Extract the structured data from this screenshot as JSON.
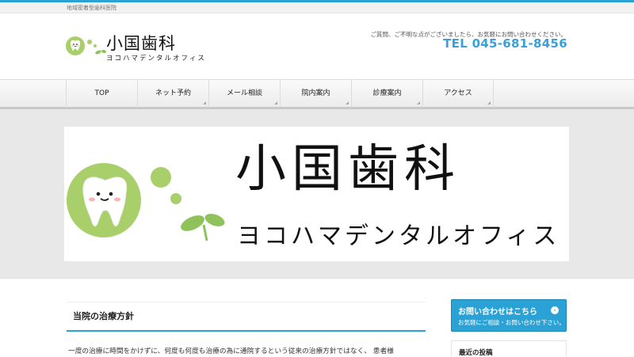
{
  "tagline": "地域密着型歯科医院",
  "header": {
    "logo_title": "小国歯科",
    "logo_subtitle": "ヨコハマデンタルオフィス",
    "contact_message": "ご質問、ご不明な点がございましたら、お気軽にお問い合わせください。",
    "tel": "TEL 045-681-8456"
  },
  "nav": {
    "items": [
      {
        "label": "TOP"
      },
      {
        "label": "ネット予約"
      },
      {
        "label": "メール相談"
      },
      {
        "label": "院内案内"
      },
      {
        "label": "診療案内"
      },
      {
        "label": "アクセス"
      }
    ]
  },
  "hero": {
    "title": "小国歯科",
    "subtitle": "ヨコハマデンタルオフィス"
  },
  "main": {
    "heading": "当院の治療方針",
    "text": "一度の治療に時間をかけずに、何度も何度も治療の為に通院するという従来の治療方針ではなく、 患者様"
  },
  "sidebar": {
    "contact_banner_title": "お問い合わせはこちら",
    "contact_banner_sub": "お気軽にご相談・お問い合わせ下さい。",
    "recent_posts_title": "最近の投稿"
  },
  "colors": {
    "accent": "#2aa2d6",
    "tooth_green": "#a8cf6a",
    "leaf_green": "#8fc25a"
  },
  "icons": [
    "tooth-mascot-icon",
    "leaf-sprout-icon",
    "arrow-circle-icon"
  ]
}
